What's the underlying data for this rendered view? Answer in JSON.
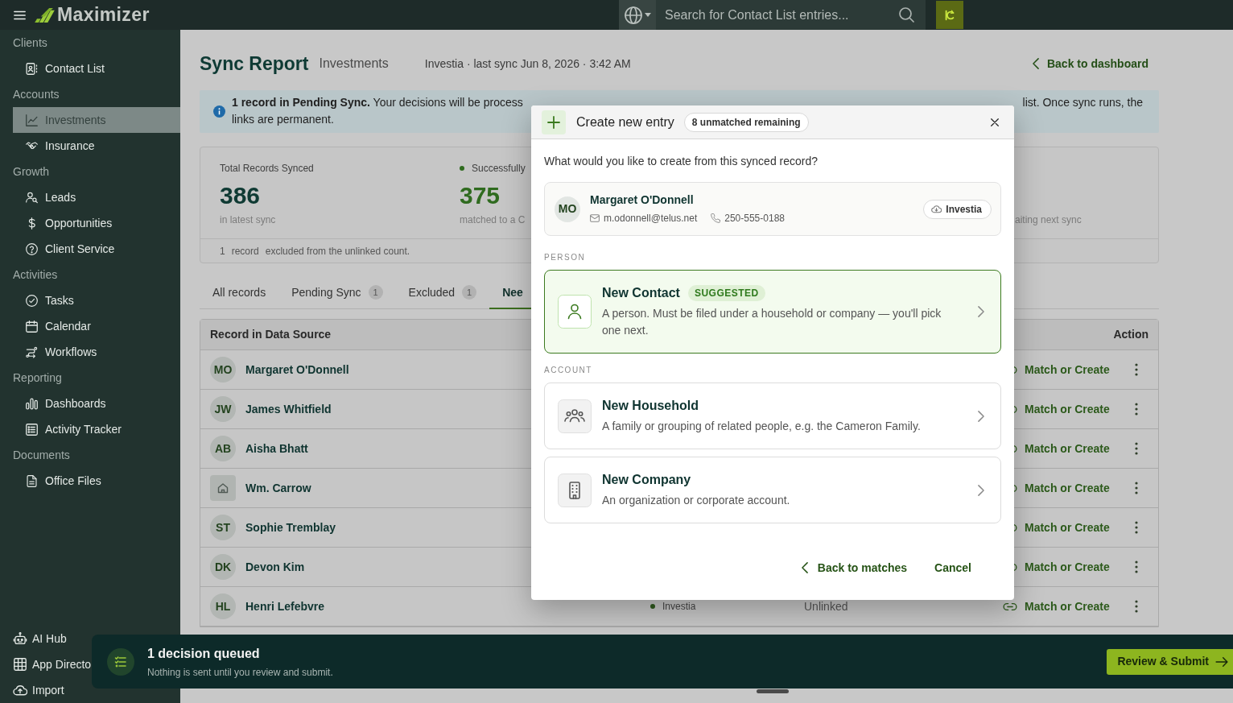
{
  "topbar": {
    "app_name": "Maximizer",
    "search": {
      "placeholder": "Search for Contact List entries..."
    }
  },
  "sidebar": {
    "sections": [
      {
        "label": "Clients",
        "items": [
          {
            "label": "Contact List",
            "selected": false
          }
        ]
      },
      {
        "label": "Accounts",
        "items": [
          {
            "label": "Investments",
            "selected": true
          },
          {
            "label": "Insurance",
            "selected": false
          }
        ]
      },
      {
        "label": "Growth",
        "items": [
          {
            "label": "Leads",
            "selected": false
          },
          {
            "label": "Opportunities",
            "selected": false
          },
          {
            "label": "Client Service",
            "selected": false
          }
        ]
      },
      {
        "label": "Activities",
        "items": [
          {
            "label": "Tasks",
            "selected": false
          },
          {
            "label": "Calendar",
            "selected": false
          },
          {
            "label": "Workflows",
            "selected": false
          }
        ]
      },
      {
        "label": "Reporting",
        "items": [
          {
            "label": "Dashboards",
            "selected": false
          },
          {
            "label": "Activity Tracker",
            "selected": false
          }
        ]
      },
      {
        "label": "Documents",
        "items": [
          {
            "label": "Office Files",
            "selected": false
          }
        ]
      }
    ],
    "footer_items": [
      {
        "label": "AI Hub",
        "selected": false
      },
      {
        "label": "App Directo",
        "selected": false
      },
      {
        "label": "Import",
        "selected": false
      }
    ]
  },
  "header": {
    "title": "Sync Report",
    "subtitle": "Investments",
    "meta": "Investia · last sync Jun 8, 2026 · 3:42 AM",
    "back_link": "Back to dashboard"
  },
  "banner": {
    "lines": [
      [
        "**1 record in Pending Sync.** Your decisions will be process",
        "list. Once sync runs, the"
      ],
      [
        "links are permanent."
      ]
    ]
  },
  "stats": {
    "items": [
      {
        "label": "Total Records Synced",
        "value": "386",
        "caption": "in latest sync"
      },
      {
        "label": "Successfully",
        "value": "375",
        "caption": "matched to a C",
        "color": "#2f6b1f"
      },
      {
        "caption": "aiting next sync"
      }
    ],
    "footnote": {
      "count": "1",
      "unit": "record",
      "text": "excluded from the unlinked count."
    }
  },
  "tabs": [
    {
      "label": "All records",
      "selected": false
    },
    {
      "label": "Pending Sync",
      "count": "1",
      "selected": false
    },
    {
      "label": "Excluded",
      "count": "1",
      "selected": false
    },
    {
      "label": "Nee",
      "selected": true
    }
  ],
  "table": {
    "columns": [
      "Record in Data Source",
      "Action"
    ],
    "rows": [
      {
        "kind": "person",
        "initials": "MO",
        "name": "Margaret O'Donnell",
        "action": "Match or Create"
      },
      {
        "kind": "person",
        "initials": "JW",
        "name": "James Whitfield",
        "action": "Match or Create"
      },
      {
        "kind": "person",
        "initials": "AB",
        "name": "Aisha Bhatt",
        "action": "Match or Create"
      },
      {
        "kind": "household",
        "name": "Wm. Carrow",
        "action": "Match or Create"
      },
      {
        "kind": "person",
        "initials": "ST",
        "name": "Sophie Tremblay",
        "action": "Match or Create"
      },
      {
        "kind": "person",
        "initials": "DK",
        "name": "Devon Kim",
        "action": "Match or Create"
      },
      {
        "kind": "person",
        "initials": "HL",
        "name": "Henri Lefebvre",
        "source": {
          "label": "Investia",
          "color": "#2f5a1e"
        },
        "status": "Unlinked",
        "action": "Match or Create"
      }
    ]
  },
  "modal": {
    "title": "Create new entry",
    "badge": "8 unmatched remaining",
    "prompt": "What would you like to create from this synced record?",
    "record": {
      "initials": "MO",
      "name": "Margaret O'Donnell",
      "email": "m.odonnell@telus.net",
      "phone": "250-555-0188",
      "source": "Investia"
    },
    "sections": [
      {
        "label": "PERSON",
        "options": [
          {
            "kind": "contact",
            "title": "New Contact",
            "tag": "SUGGESTED",
            "description": "A person. Must be filed under a household or company — you'll pick one next.",
            "selected": true
          }
        ]
      },
      {
        "label": "ACCOUNT",
        "options": [
          {
            "kind": "household",
            "title": "New Household",
            "description": "A family or grouping of related people, e.g. the Cameron Family.",
            "selected": false
          },
          {
            "kind": "company",
            "title": "New Company",
            "description": "An organization or corporate account.",
            "selected": false
          }
        ]
      }
    ],
    "back": "Back to matches",
    "cancel": "Cancel"
  },
  "toast": {
    "title": "1 decision queued",
    "message": "Nothing is sent until you review and submit.",
    "button": "Review & Submit"
  }
}
